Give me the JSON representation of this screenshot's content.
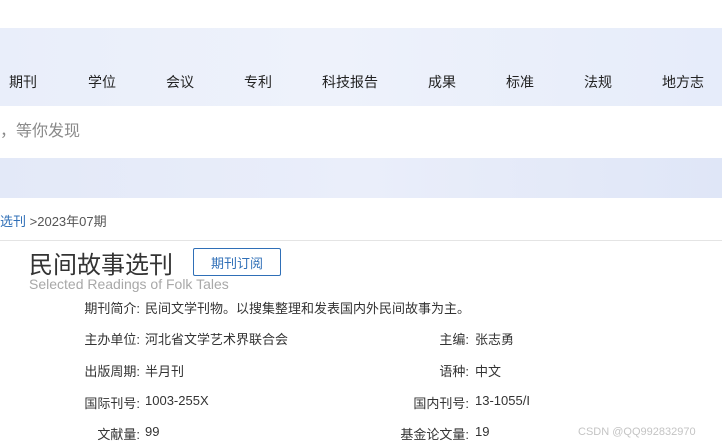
{
  "nav": {
    "items": [
      "期刊",
      "学位",
      "会议",
      "专利",
      "科技报告",
      "成果",
      "标准",
      "法规",
      "地方志"
    ]
  },
  "search": {
    "placeholder": "，等你发现"
  },
  "breadcrumb": {
    "link": "选刊",
    "current": ">2023年07期"
  },
  "journal": {
    "title": "民间故事选刊",
    "subscribe_label": "期刊订阅",
    "english_title": "Selected Readings of Folk Tales",
    "intro_label": "期刊简介:",
    "intro_value": "民间文学刊物。以搜集整理和发表国内外民间故事为主。",
    "sponsor_label": "主办单位:",
    "sponsor_value": "河北省文学艺术界联合会",
    "editor_label": "主编:",
    "editor_value": "张志勇",
    "cycle_label": "出版周期:",
    "cycle_value": "半月刊",
    "language_label": "语种:",
    "language_value": "中文",
    "issn_label": "国际刊号:",
    "issn_value": "1003-255X",
    "cn_label": "国内刊号:",
    "cn_value": "13-1055/I",
    "docs_label": "文献量:",
    "docs_value": "99",
    "fund_label": "基金论文量:",
    "fund_value": "19"
  },
  "watermark": "CSDN @QQ992832970"
}
